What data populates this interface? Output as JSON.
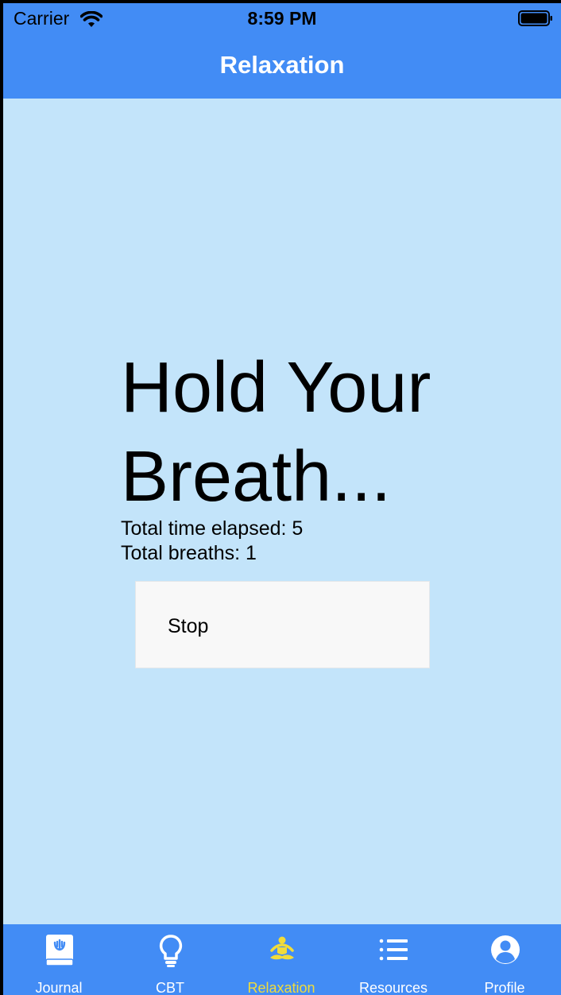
{
  "status_bar": {
    "carrier": "Carrier",
    "time": "8:59 PM"
  },
  "nav": {
    "title": "Relaxation"
  },
  "main": {
    "heading": "Hold Your Breath...",
    "time_elapsed": "Total time elapsed: 5",
    "breaths": "Total breaths: 1",
    "stop_label": "Stop"
  },
  "tabs": [
    {
      "label": "Journal",
      "icon": "journal-icon"
    },
    {
      "label": "CBT",
      "icon": "lightbulb-icon"
    },
    {
      "label": "Relaxation",
      "icon": "meditation-icon",
      "active": true
    },
    {
      "label": "Resources",
      "icon": "list-icon"
    },
    {
      "label": "Profile",
      "icon": "user-icon"
    }
  ],
  "colors": {
    "accent": "#428cf5",
    "background": "#c3e4fa",
    "active_tab": "#f1dc3a"
  }
}
